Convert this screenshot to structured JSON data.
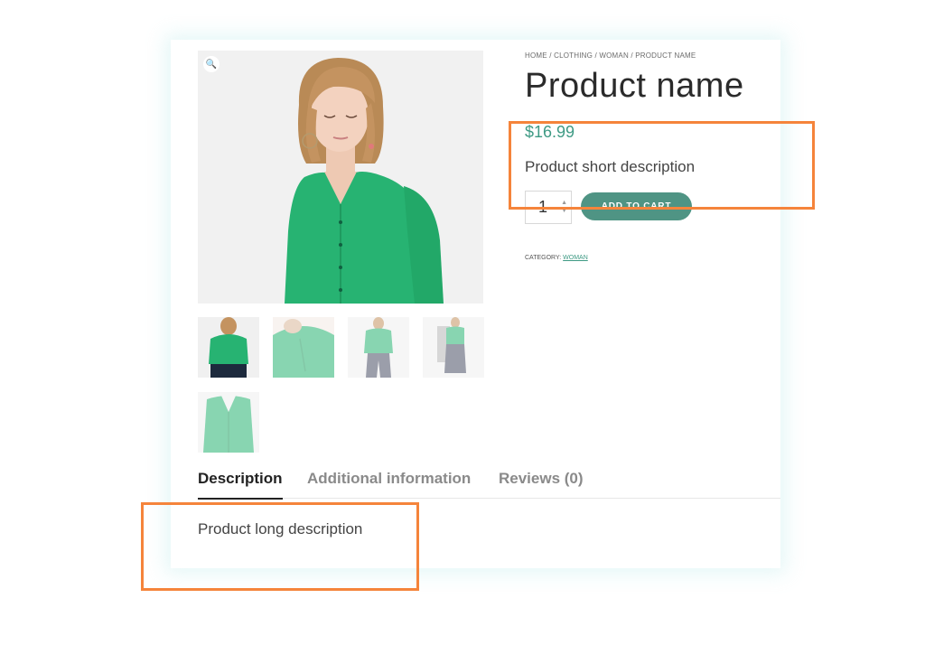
{
  "breadcrumb": [
    "Home",
    "Clothing",
    "Woman",
    "Product name"
  ],
  "breadcrumb_separator": "/",
  "product": {
    "title": "Product name",
    "price": "$16.99",
    "short_description": "Product short description",
    "quantity": "1",
    "add_to_cart_label": "ADD TO CART",
    "category_label": "CATEGORY:",
    "category_value": "WOMAN",
    "long_description": "Product long description"
  },
  "gallery": {
    "zoom_icon": "magnifier-icon",
    "thumbnail_count": 5
  },
  "tabs": [
    {
      "label": "Description",
      "active": true
    },
    {
      "label": "Additional information",
      "active": false
    },
    {
      "label": "Reviews (0)",
      "active": false
    }
  ],
  "colors": {
    "accent": "#3e9a84",
    "button": "#4f9484",
    "highlight": "#f5843b",
    "product_green": "#27b372"
  }
}
